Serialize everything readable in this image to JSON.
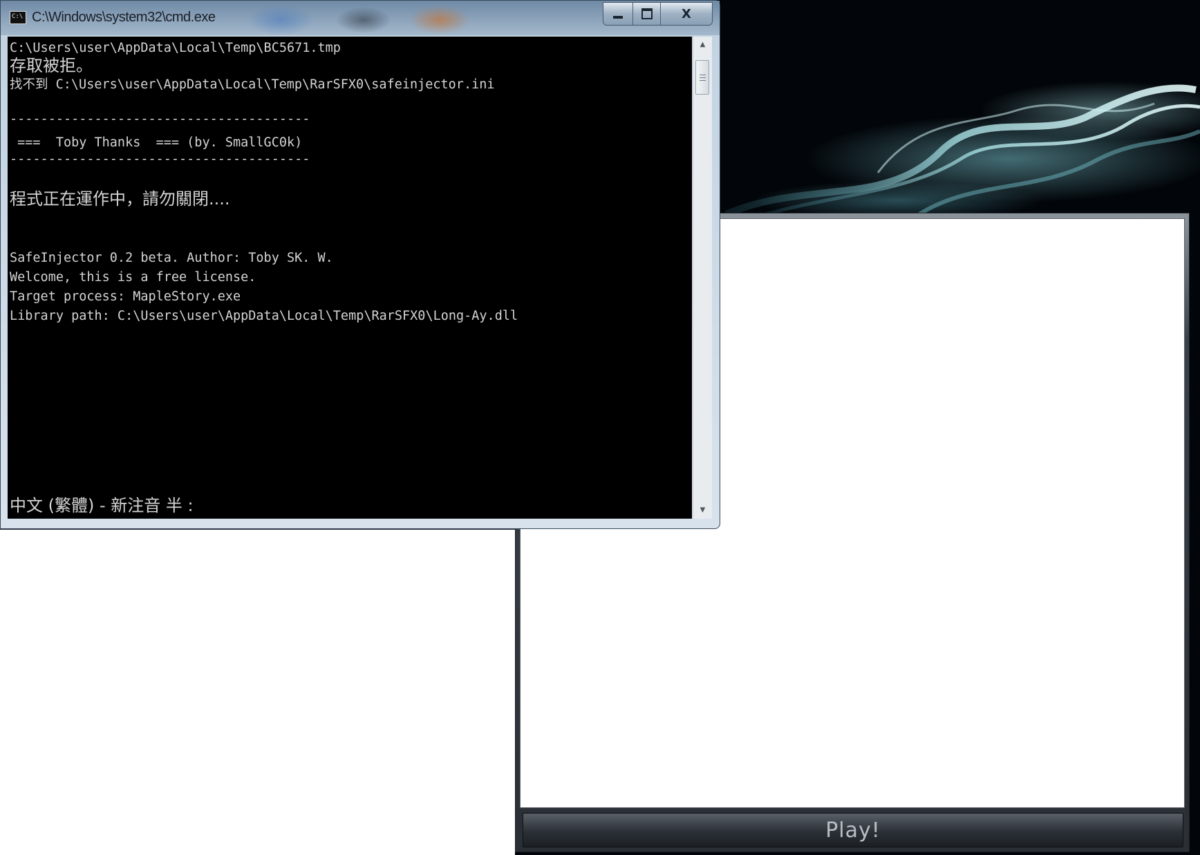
{
  "desktop": {
    "wallpaper": "dark-smoke",
    "accent": "#7ec6cc"
  },
  "cmd_window": {
    "title": "C:\\Windows\\system32\\cmd.exe",
    "icon": "cmd-icon",
    "icon_label": "C:\\",
    "controls": {
      "minimize": "minimize",
      "maximize": "maximize",
      "close": "X"
    },
    "console_lines": [
      "C:\\Users\\user\\AppData\\Local\\Temp\\BC5671.tmp",
      "存取被拒。",
      "找不到 C:\\Users\\user\\AppData\\Local\\Temp\\RarSFX0\\safeinjector.ini",
      "",
      "---------------------------------------",
      " ===  Toby Thanks  === (by. SmallGC0k)",
      "---------------------------------------",
      "",
      "程式正在運作中，請勿關閉....",
      "",
      "SafeInjector 0.2 beta. Author: Toby SK. W.",
      "Welcome, this is a free license.",
      "Target process: MapleStory.exe",
      "Library path: C:\\Users\\user\\AppData\\Local\\Temp\\RarSFX0\\Long-Ay.dll"
    ],
    "ime_status": "中文 (繁體) - 新注音 半 :"
  },
  "launcher_window": {
    "play_label": "Play!"
  }
}
